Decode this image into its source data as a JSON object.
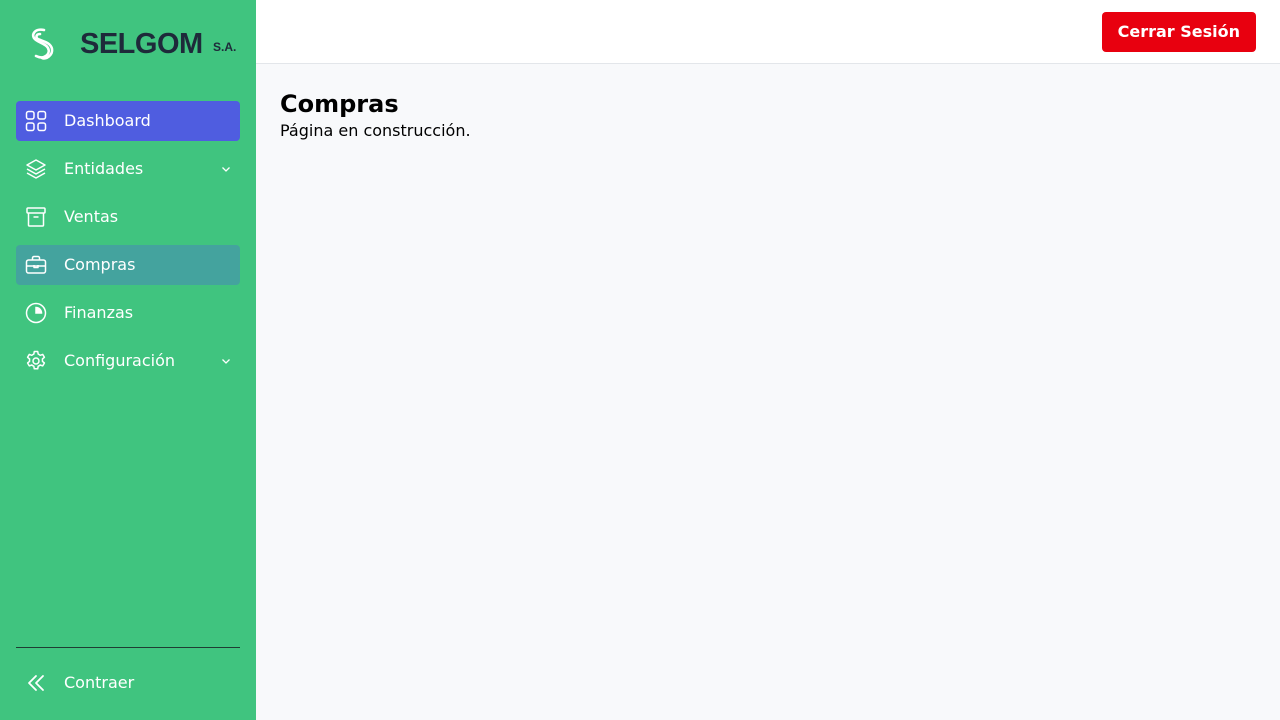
{
  "brand": {
    "name": "SELGOM",
    "suffix": "S.A.",
    "logo_icon": "s-logo-icon"
  },
  "sidebar": {
    "items": [
      {
        "label": "Dashboard",
        "icon": "grid-icon",
        "state": "highlighted"
      },
      {
        "label": "Entidades",
        "icon": "layers-icon",
        "has_submenu": true
      },
      {
        "label": "Ventas",
        "icon": "box-icon"
      },
      {
        "label": "Compras",
        "icon": "briefcase-icon",
        "state": "current"
      },
      {
        "label": "Finanzas",
        "icon": "pie-chart-icon"
      },
      {
        "label": "Configuración",
        "icon": "gear-icon",
        "has_submenu": true
      }
    ],
    "collapse_label": "Contraer",
    "collapse_icon": "double-chevron-left-icon"
  },
  "header": {
    "logout_label": "Cerrar Sesión"
  },
  "main": {
    "title": "Compras",
    "subtitle": "Página en construcción."
  },
  "colors": {
    "sidebar_bg": "#40c47f",
    "highlight": "#4f5de0",
    "current": "#44a39e",
    "logout": "#e8000f",
    "brand_text": "#1e2a3a",
    "content_bg": "#f8f9fb"
  }
}
